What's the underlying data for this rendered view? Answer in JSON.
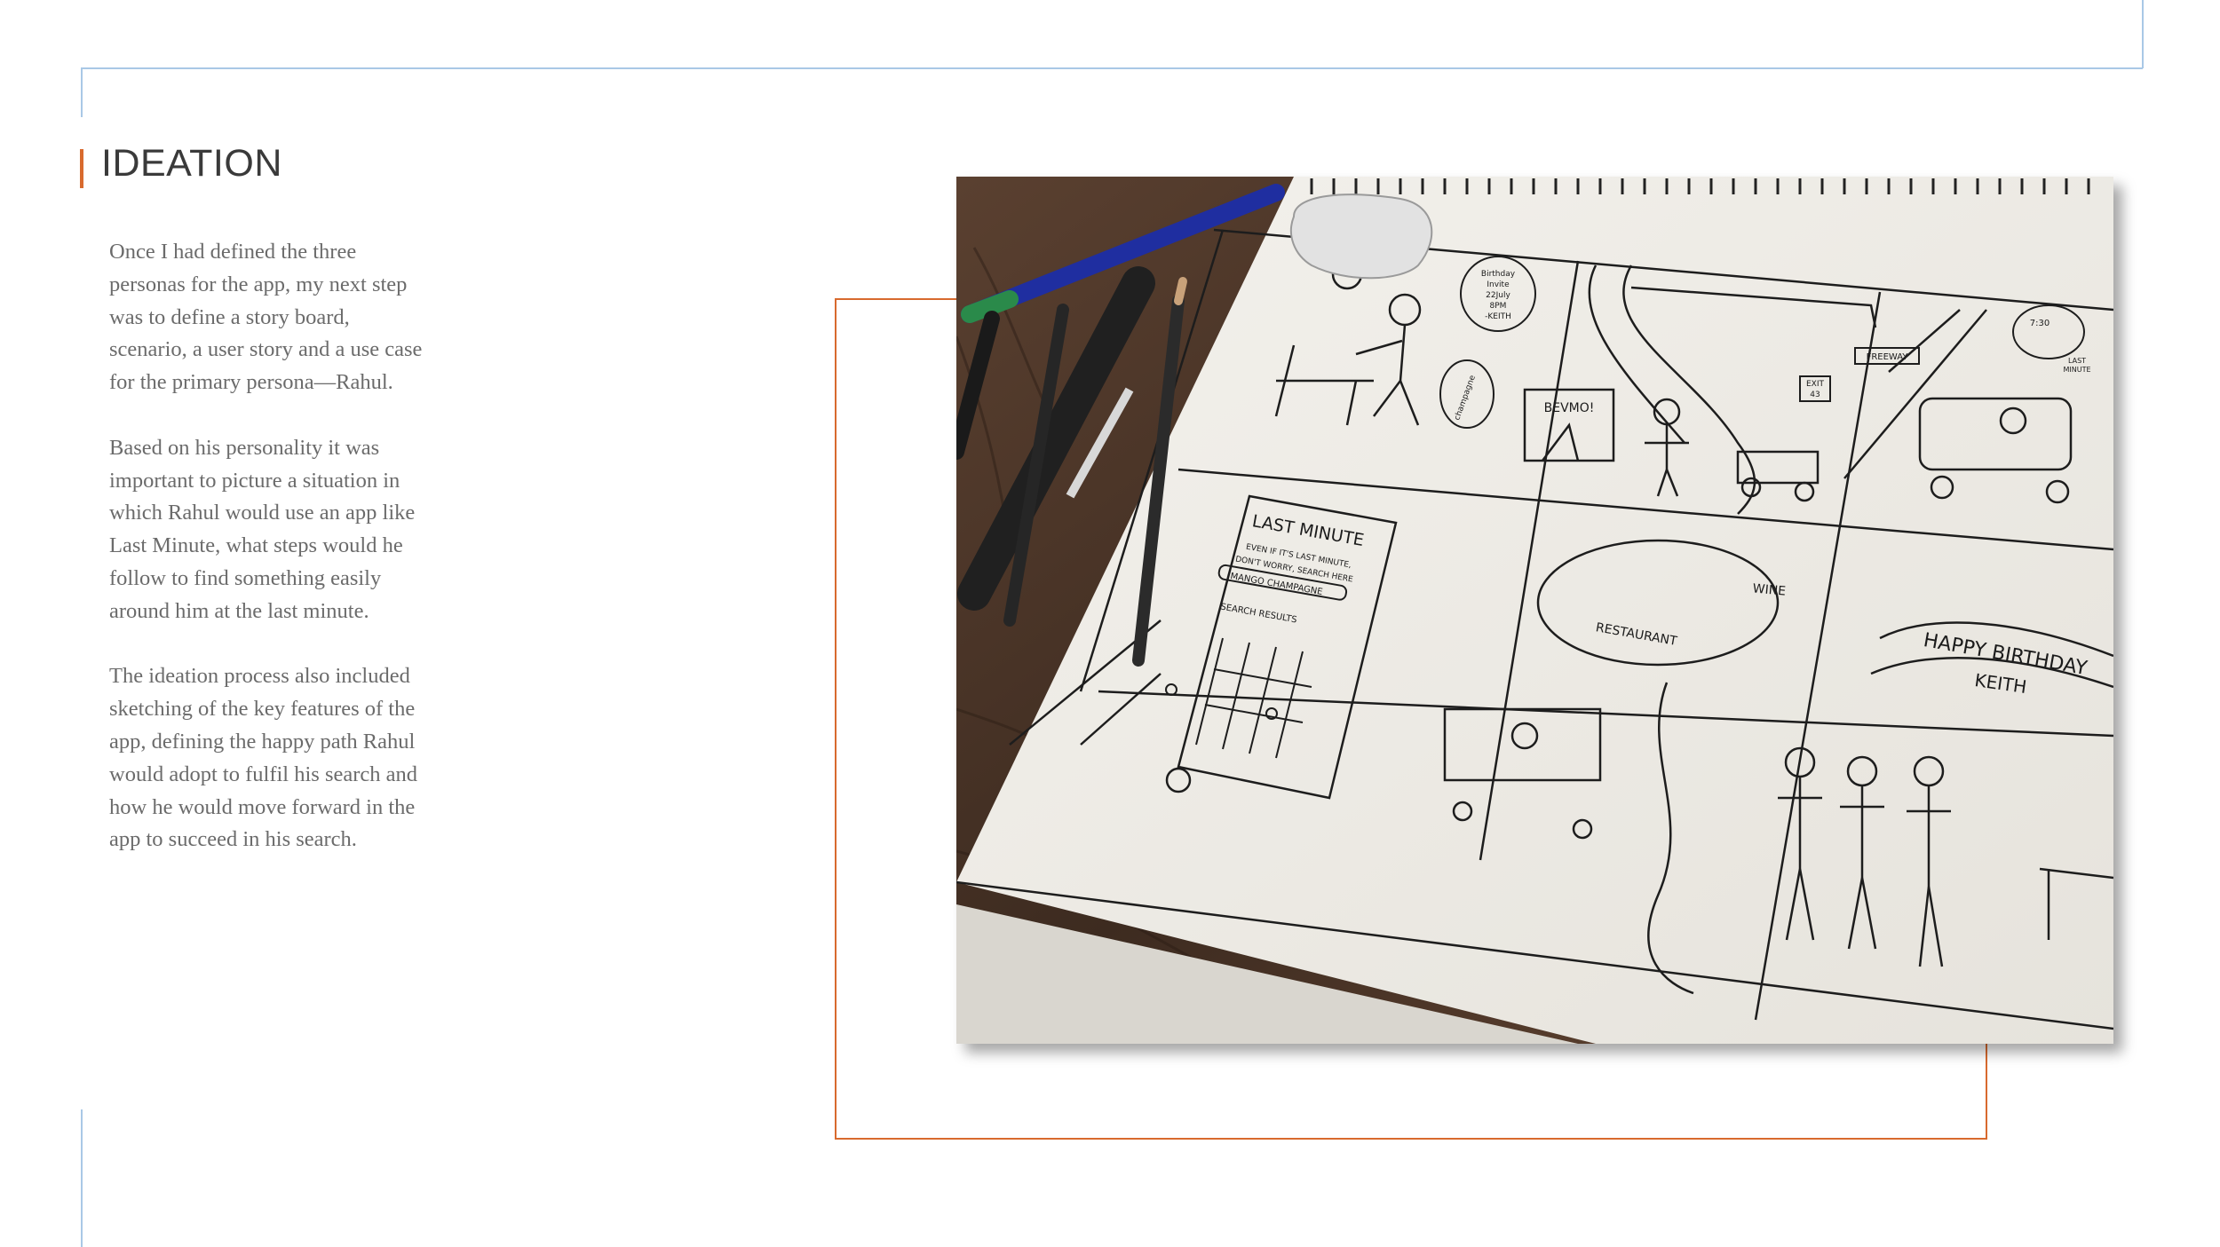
{
  "heading": "IDEATION",
  "paragraphs": [
    "Once I had defined the three personas for the app, my next step was to define a story board, scenario, a user story and a use case for the primary persona—Rahul.",
    "Based on his personality it was important to picture a situation in which Rahul would use an app like Last Minute, what steps would he follow to find something easily around him at the last minute.",
    "The ideation process also included sketching of the key features of the app, defining the happy path Rahul would adopt to fulfil his search and how he would move forward in the app to succeed in his search."
  ],
  "sketch": {
    "invite": [
      "Birthday",
      "Invite",
      "22July",
      "8PM",
      "-KEITH"
    ],
    "bottle": "champagne",
    "store": "BEVMO!",
    "exit_sign": [
      "EXIT",
      "43"
    ],
    "freeway_sign": "FREEWAY",
    "time": "7:30",
    "cloud_text": [
      "LAST",
      "MINUTE"
    ],
    "app_title": "LAST MINUTE",
    "app_tagline": [
      "EVEN IF IT'S LAST MINUTE,",
      "DON'T WORRY, SEARCH HERE"
    ],
    "search_value": "MANGO CHAMPAGNE",
    "results_label": "SEARCH RESULTS",
    "wine_label": "WINE",
    "restaurant_label": "RESTAURANT",
    "banner": [
      "HAPPY BIRTHDAY",
      "KEITH"
    ]
  },
  "colors": {
    "accent": "#d86a2e",
    "frame": "#a9c8e6",
    "heading": "#3a3a3a",
    "body": "#6b6b6b"
  }
}
